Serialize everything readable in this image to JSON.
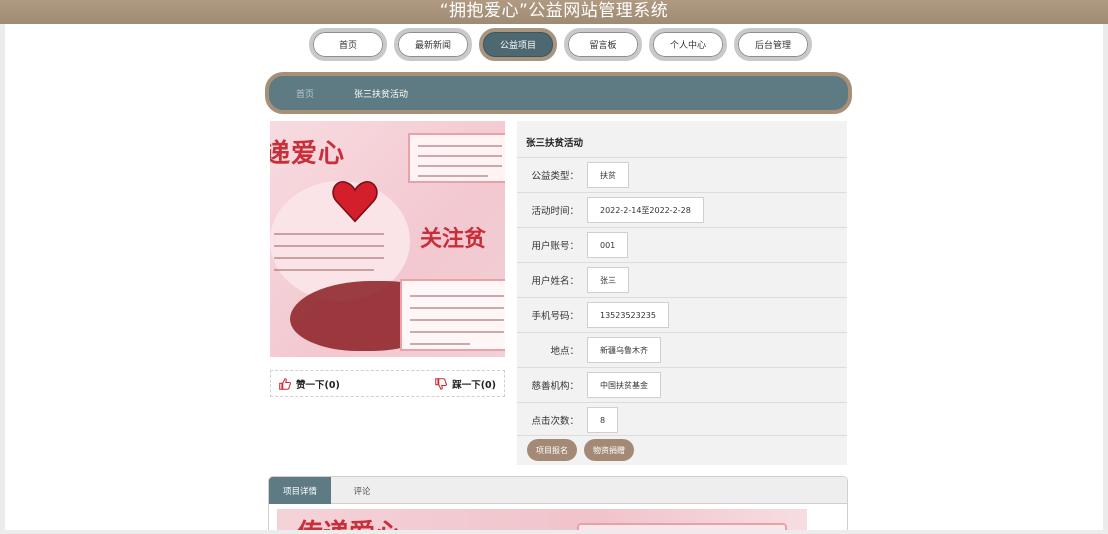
{
  "header": {
    "title": "“拥抱爱心”公益网站管理系统"
  },
  "nav": {
    "items": [
      {
        "label": "首页"
      },
      {
        "label": "最新新闻"
      },
      {
        "label": "公益项目"
      },
      {
        "label": "留言板"
      },
      {
        "label": "个人中心"
      },
      {
        "label": "后台管理"
      }
    ],
    "active_index": 2
  },
  "breadcrumb": {
    "home": "首页",
    "current": "张三扶贫活动"
  },
  "colors": {
    "header": "#a89580",
    "accent": "#5e7b84",
    "button": "#a48a76"
  },
  "votes": {
    "like": "赞一下(0)",
    "dislike": "踩一下(0)"
  },
  "info": {
    "title": "张三扶贫活动",
    "fields": [
      {
        "label": "公益类型：",
        "value": "扶贫"
      },
      {
        "label": "活动时间：",
        "value": "2022-2-14至2022-2-28"
      },
      {
        "label": "用户账号：",
        "value": "001"
      },
      {
        "label": "用户姓名：",
        "value": "张三"
      },
      {
        "label": "手机号码：",
        "value": "13523523235"
      },
      {
        "label": "地点：",
        "value": "新疆乌鲁木齐"
      },
      {
        "label": "慈善机构：",
        "value": "中国扶贫基金"
      },
      {
        "label": "点击次数：",
        "value": "8"
      }
    ],
    "buttons": {
      "signup": "项目报名",
      "donate": "物资捐赠"
    }
  },
  "tabs": {
    "detail": "项目详情",
    "comments": "评论"
  }
}
